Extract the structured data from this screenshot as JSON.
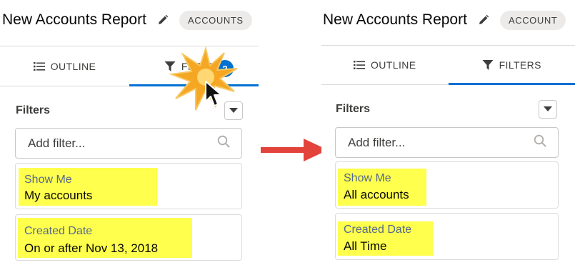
{
  "before": {
    "report_title": "New Accounts Report",
    "report_type_badge": "ACCOUNTS",
    "tabs": [
      {
        "label": "OUTLINE",
        "active": false
      },
      {
        "label": "FILTERS",
        "active": true,
        "count": "2"
      }
    ],
    "filters_heading": "Filters",
    "add_filter_placeholder": "Add filter...",
    "filters": [
      {
        "label": "Show Me",
        "value": "My accounts"
      },
      {
        "label": "Created Date",
        "value": "On or after Nov 13, 2018"
      }
    ]
  },
  "after": {
    "report_title": "New Accounts Report",
    "report_type_badge": "ACCOUNT",
    "tabs": [
      {
        "label": "OUTLINE",
        "active": false
      },
      {
        "label": "FILTERS",
        "active": true
      }
    ],
    "filters_heading": "Filters",
    "add_filter_placeholder": "Add filter...",
    "filters": [
      {
        "label": "Show Me",
        "value": "All accounts"
      },
      {
        "label": "Created Date",
        "value": "All Time"
      }
    ]
  },
  "colors": {
    "highlight": "#ffff4d",
    "accent": "#0070d2",
    "arrow": "#e2433b",
    "click_burst": "#f5a623"
  },
  "icons": [
    "pencil-icon",
    "list-icon",
    "filter-funnel-icon",
    "chevron-down-icon",
    "search-icon",
    "arrow-right-icon",
    "cursor-icon",
    "click-burst-icon"
  ]
}
